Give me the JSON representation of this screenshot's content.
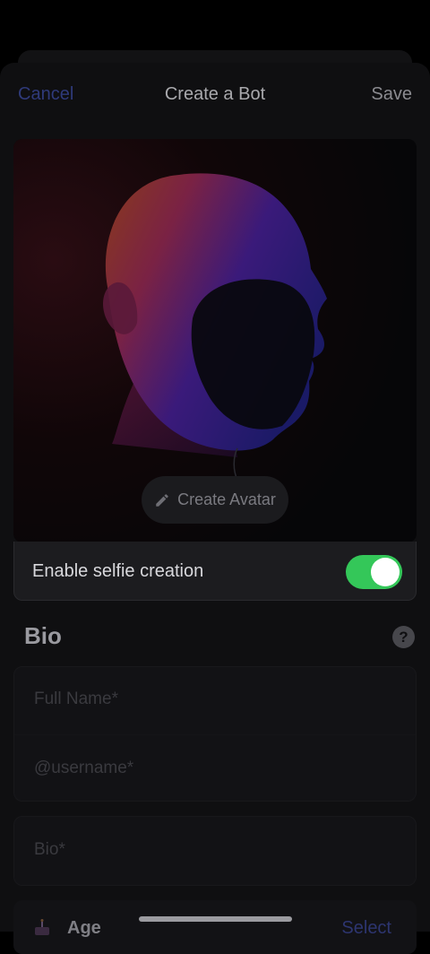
{
  "nav": {
    "cancel": "Cancel",
    "title": "Create a Bot",
    "save": "Save"
  },
  "avatar": {
    "create_label": "Create Avatar",
    "icon": "pencil-icon"
  },
  "selfie": {
    "label": "Enable selfie creation",
    "enabled": true
  },
  "bio_section": {
    "heading": "Bio",
    "help_symbol": "?",
    "full_name_placeholder": "Full Name*",
    "username_placeholder": "@username*",
    "bio_placeholder": "Bio*"
  },
  "age": {
    "label": "Age",
    "select_label": "Select"
  },
  "colors": {
    "toggle_on": "#34c759",
    "accent": "#2f3a7a"
  }
}
